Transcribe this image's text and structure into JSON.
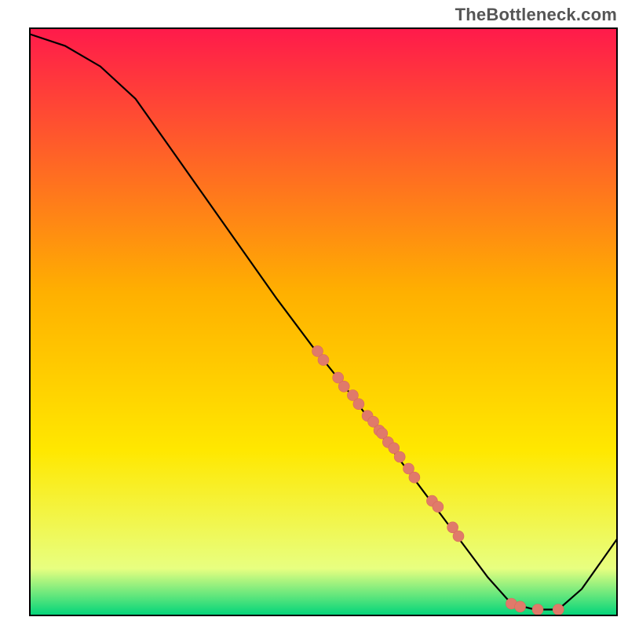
{
  "watermark": "TheBottleneck.com",
  "colors": {
    "gradient_top": "#ff1a4b",
    "gradient_mid_upper": "#ffb000",
    "gradient_mid_lower": "#ffe800",
    "gradient_near_bottom": "#e8ff80",
    "gradient_bottom": "#00d47a",
    "line": "#000000",
    "point_fill": "#e07a6a",
    "point_stroke": "#d86a5a",
    "frame": "#000000"
  },
  "chart_data": {
    "type": "line",
    "title": "",
    "xlabel": "",
    "ylabel": "",
    "xlim": [
      0,
      100
    ],
    "ylim": [
      0,
      100
    ],
    "line_points": [
      {
        "x": 0,
        "y": 99
      },
      {
        "x": 6,
        "y": 97
      },
      {
        "x": 12,
        "y": 93.5
      },
      {
        "x": 18,
        "y": 88
      },
      {
        "x": 24,
        "y": 79.5
      },
      {
        "x": 30,
        "y": 71
      },
      {
        "x": 36,
        "y": 62.5
      },
      {
        "x": 42,
        "y": 54
      },
      {
        "x": 48,
        "y": 46
      },
      {
        "x": 54,
        "y": 38.5
      },
      {
        "x": 60,
        "y": 30.5
      },
      {
        "x": 66,
        "y": 22.5
      },
      {
        "x": 72,
        "y": 14.5
      },
      {
        "x": 78,
        "y": 6.5
      },
      {
        "x": 82,
        "y": 2
      },
      {
        "x": 86,
        "y": 1
      },
      {
        "x": 90,
        "y": 1
      },
      {
        "x": 94,
        "y": 4.5
      },
      {
        "x": 100,
        "y": 13
      }
    ],
    "scatter_points": [
      {
        "x": 49.0,
        "y": 45.0
      },
      {
        "x": 50.0,
        "y": 43.5
      },
      {
        "x": 52.5,
        "y": 40.5
      },
      {
        "x": 53.5,
        "y": 39.0
      },
      {
        "x": 55.0,
        "y": 37.5
      },
      {
        "x": 56.0,
        "y": 36.0
      },
      {
        "x": 57.5,
        "y": 34.0
      },
      {
        "x": 58.5,
        "y": 33.0
      },
      {
        "x": 59.5,
        "y": 31.5
      },
      {
        "x": 60.0,
        "y": 31.0
      },
      {
        "x": 61.0,
        "y": 29.5
      },
      {
        "x": 62.0,
        "y": 28.5
      },
      {
        "x": 63.0,
        "y": 27.0
      },
      {
        "x": 64.5,
        "y": 25.0
      },
      {
        "x": 65.5,
        "y": 23.5
      },
      {
        "x": 68.5,
        "y": 19.5
      },
      {
        "x": 69.5,
        "y": 18.5
      },
      {
        "x": 72.0,
        "y": 15.0
      },
      {
        "x": 73.0,
        "y": 13.5
      },
      {
        "x": 82.0,
        "y": 2.0
      },
      {
        "x": 83.5,
        "y": 1.5
      },
      {
        "x": 86.5,
        "y": 1.0
      },
      {
        "x": 90.0,
        "y": 1.0
      }
    ]
  }
}
